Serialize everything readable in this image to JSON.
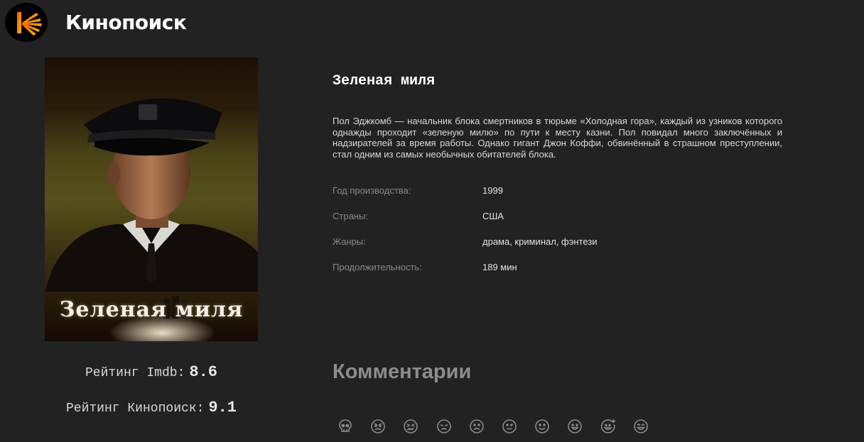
{
  "header": {
    "logo_text": "Кинопоиск",
    "brand_color": "#ff5500"
  },
  "poster": {
    "title_text": "Зеленая миля",
    "alt": "poster"
  },
  "ratings": {
    "imdb_label": "Рейтинг Imdb:",
    "imdb_value": "8.6",
    "kinopoisk_label": "Рейтинг Кинопоиск:",
    "kinopoisk_value": "9.1"
  },
  "film": {
    "title": "Зеленая миля",
    "description": "Пол Эджкомб — начальник блока смертников в тюрьме «Холодная гора», каждый из узников которого однажды проходит «зеленую милю» по пути к месту казни. Пол повидал много заключённых и надзирателей за время работы. Однако гигант Джон Коффи, обвинённый в страшном преступлении, стал одним из самых необычных обитателей блока.",
    "info": [
      {
        "label": "Год производства:",
        "value": "1999"
      },
      {
        "label": "Страны:",
        "value": "США"
      },
      {
        "label": "Жанры:",
        "value": "драма, криминал, фэнтези"
      },
      {
        "label": "Продолжительность:",
        "value": "189 мин"
      }
    ]
  },
  "comments": {
    "title": "Комментарии",
    "reactions": [
      "skull-icon",
      "angry-face-icon",
      "confounded-face-icon",
      "persevering-face-icon",
      "frowning-face-icon",
      "neutral-face-icon",
      "slight-smile-icon",
      "grinning-face-icon",
      "star-struck-face-icon",
      "big-smile-icon"
    ]
  }
}
